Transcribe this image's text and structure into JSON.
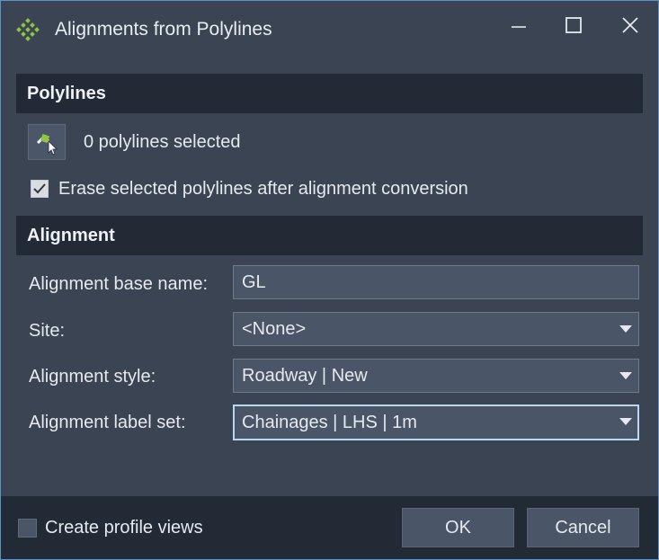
{
  "window": {
    "title": "Alignments from Polylines"
  },
  "polylines_section": {
    "header": "Polylines",
    "selected_count_text": "0 polylines selected",
    "erase_checkbox": {
      "label": "Erase selected polylines after alignment conversion",
      "checked": true
    }
  },
  "alignment_section": {
    "header": "Alignment",
    "base_name": {
      "label": "Alignment base name:",
      "value": "GL"
    },
    "site": {
      "label": "Site:",
      "value": "<None>"
    },
    "style": {
      "label": "Alignment style:",
      "value": "Roadway | New"
    },
    "label_set": {
      "label": "Alignment label set:",
      "value": "Chainages | LHS | 1m"
    }
  },
  "footer": {
    "create_profile_views": {
      "label": "Create profile views",
      "checked": false
    },
    "ok_label": "OK",
    "cancel_label": "Cancel"
  },
  "icons": {
    "app": "alignment-diamond-icon",
    "pick": "pick-polyline-icon",
    "minimize": "minimize-icon",
    "maximize": "maximize-icon",
    "close": "close-icon"
  },
  "colors": {
    "background": "#3b4453",
    "section_header": "#222a35",
    "field": "#4a5567",
    "focus_border": "#b9d7ee",
    "app_icon_green": "#8dc63f"
  }
}
